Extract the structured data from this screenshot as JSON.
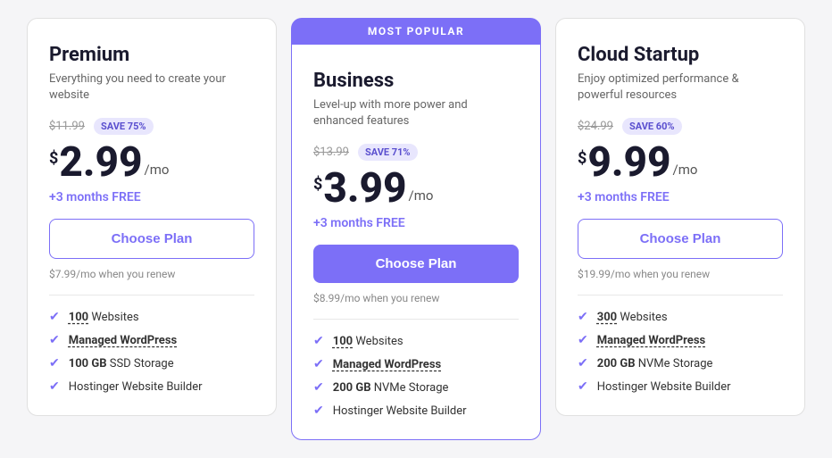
{
  "colors": {
    "accent": "#7c6ff7",
    "badge_bg": "#e8e6fd",
    "badge_text": "#5a4fcf"
  },
  "most_popular_label": "MOST POPULAR",
  "plans": [
    {
      "id": "premium",
      "name": "Premium",
      "description": "Everything you need to create your website",
      "original_price": "$11.99",
      "save_label": "SAVE 75%",
      "currency": "$",
      "price": "2.99",
      "period": "/mo",
      "free_months": "+3 months FREE",
      "cta_label": "Choose Plan",
      "cta_style": "outline",
      "renew_note": "$7.99/mo when you renew",
      "features": [
        {
          "bold": "100",
          "text": " Websites",
          "underline_bold": true
        },
        {
          "bold": "Managed WordPress",
          "text": "",
          "underline_bold": true
        },
        {
          "bold": "100 GB",
          "text": " SSD Storage",
          "underline_bold": false
        },
        {
          "bold": "",
          "text": "Hostinger Website Builder",
          "underline_bold": false
        }
      ]
    },
    {
      "id": "business",
      "name": "Business",
      "description": "Level-up with more power and enhanced features",
      "original_price": "$13.99",
      "save_label": "SAVE 71%",
      "currency": "$",
      "price": "3.99",
      "period": "/mo",
      "free_months": "+3 months FREE",
      "cta_label": "Choose Plan",
      "cta_style": "filled",
      "renew_note": "$8.99/mo when you renew",
      "features": [
        {
          "bold": "100",
          "text": " Websites",
          "underline_bold": true
        },
        {
          "bold": "Managed WordPress",
          "text": "",
          "underline_bold": true
        },
        {
          "bold": "200 GB",
          "text": " NVMe Storage",
          "underline_bold": false
        },
        {
          "bold": "",
          "text": "Hostinger Website Builder",
          "underline_bold": false
        }
      ]
    },
    {
      "id": "cloud-startup",
      "name": "Cloud Startup",
      "description": "Enjoy optimized performance & powerful resources",
      "original_price": "$24.99",
      "save_label": "SAVE 60%",
      "currency": "$",
      "price": "9.99",
      "period": "/mo",
      "free_months": "+3 months FREE",
      "cta_label": "Choose Plan",
      "cta_style": "outline",
      "renew_note": "$19.99/mo when you renew",
      "features": [
        {
          "bold": "300",
          "text": " Websites",
          "underline_bold": true
        },
        {
          "bold": "Managed WordPress",
          "text": "",
          "underline_bold": true
        },
        {
          "bold": "200 GB",
          "text": " NVMe Storage",
          "underline_bold": false
        },
        {
          "bold": "",
          "text": "Hostinger Website Builder",
          "underline_bold": false
        }
      ]
    }
  ]
}
